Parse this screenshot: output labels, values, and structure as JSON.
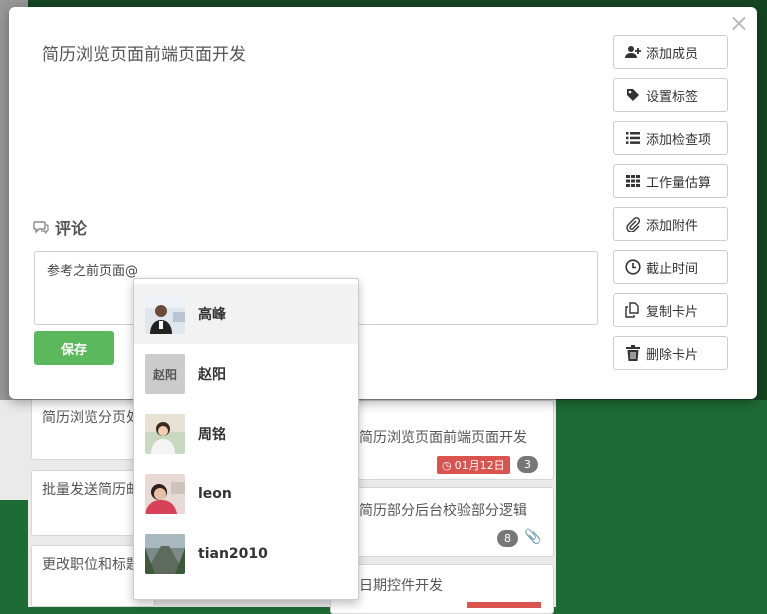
{
  "modal": {
    "card_title": "简历浏览页面前端页面开发",
    "close": "×",
    "comment_heading": "评论",
    "comment_text": "参考之前页面@",
    "save_label": "保存"
  },
  "actions": [
    {
      "label": "添加成员",
      "icon": "add-user-icon"
    },
    {
      "label": "设置标签",
      "icon": "tag-icon"
    },
    {
      "label": "添加检查项",
      "icon": "list-icon"
    },
    {
      "label": "工作量估算",
      "icon": "grid-icon"
    },
    {
      "label": "添加附件",
      "icon": "paperclip-icon"
    },
    {
      "label": "截止时间",
      "icon": "clock-icon"
    },
    {
      "label": "复制卡片",
      "icon": "copy-icon"
    },
    {
      "label": "删除卡片",
      "icon": "trash-icon"
    }
  ],
  "mentions": [
    {
      "name": "高峰",
      "avatar": "photo"
    },
    {
      "name": "赵阳",
      "avatar_text": "赵阳"
    },
    {
      "name": "周铭",
      "avatar": "photo"
    },
    {
      "name": "leon",
      "avatar": "photo"
    },
    {
      "name": "tian2010",
      "avatar": "photo"
    }
  ],
  "background_cards": {
    "left": [
      "简历浏览分页处",
      "批量发送简历邮",
      "更改职位和标题"
    ],
    "right": [
      "简历浏览页面前端页面开发",
      "简历部分后台校验部分逻辑",
      "日期控件开发"
    ],
    "date_badge": "01月12日",
    "count_a": "3",
    "count_b": "8"
  },
  "colors": {
    "board": "#1f6b35",
    "save": "#5cb85c",
    "due": "#d9534f"
  }
}
